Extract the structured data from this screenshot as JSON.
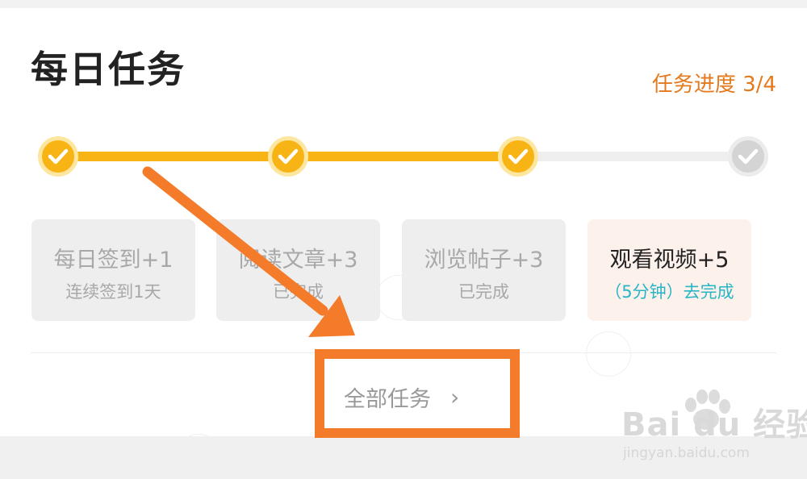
{
  "header": {
    "title": "每日任务",
    "progress_text": "任务进度 3/4"
  },
  "progress": {
    "completed": 3,
    "total": 4
  },
  "tasks": [
    {
      "name": "每日签到+1",
      "sub": "连续签到1天",
      "status": "done"
    },
    {
      "name": "阅读文章+3",
      "sub": "已完成",
      "status": "done"
    },
    {
      "name": "浏览帖子+3",
      "sub": "已完成",
      "status": "done"
    },
    {
      "name": "观看视频+5",
      "sub": "（5分钟）去完成",
      "status": "todo"
    }
  ],
  "footer": {
    "all_tasks_label": "全部任务",
    "chevron": "›"
  },
  "watermark": {
    "brand": "Bai du 经验",
    "url": "jingyan.baidu.com"
  },
  "colors": {
    "accent": "#f7b414",
    "progress_text": "#e47a1e",
    "annotation": "#f47b2a",
    "action_link": "#2ab5c5"
  },
  "icons": {
    "check": "check-icon",
    "chevron": "chevron-right-icon",
    "paw": "paw-icon"
  }
}
